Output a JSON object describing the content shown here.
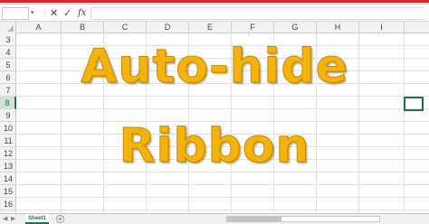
{
  "columns": [
    "A",
    "B",
    "C",
    "D",
    "E",
    "F",
    "G",
    "H",
    "I"
  ],
  "rows": [
    "3",
    "4",
    "5",
    "6",
    "7",
    "8",
    "9",
    "10",
    "11",
    "12",
    "13",
    "14",
    "15",
    "16"
  ],
  "active_row": "8",
  "headline": {
    "line1": "Auto-hide",
    "line2": "Ribbon"
  },
  "sheet_tabs": [
    "Sheet1"
  ],
  "formula_bar": {
    "cancel": "✕",
    "enter": "✓",
    "fx": "fx",
    "dots": "⋮",
    "name_caret": "▾"
  },
  "status": {
    "add_sheet": "+",
    "prev": "◀",
    "next": "▶"
  },
  "colors": {
    "ribbon_accent": "#d6252e",
    "headline_fill": "#f4b30c",
    "excel_green": "#217346"
  }
}
